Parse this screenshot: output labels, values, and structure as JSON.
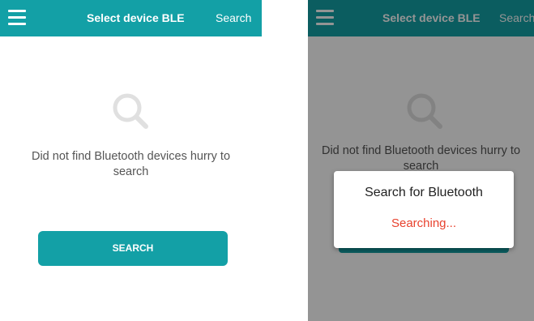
{
  "app": {
    "title": "Select device BLE",
    "search_action": "Search",
    "menu_icon": "hamburger-menu-icon",
    "accent_color": "#13a0a6"
  },
  "empty_state": {
    "icon": "search-icon",
    "message": "Did not find Bluetooth devices hurry to search"
  },
  "search_button": {
    "label": "SEARCH"
  },
  "dialog": {
    "title": "Search for Bluetooth",
    "status": "Searching...",
    "status_color": "#e8422e"
  }
}
